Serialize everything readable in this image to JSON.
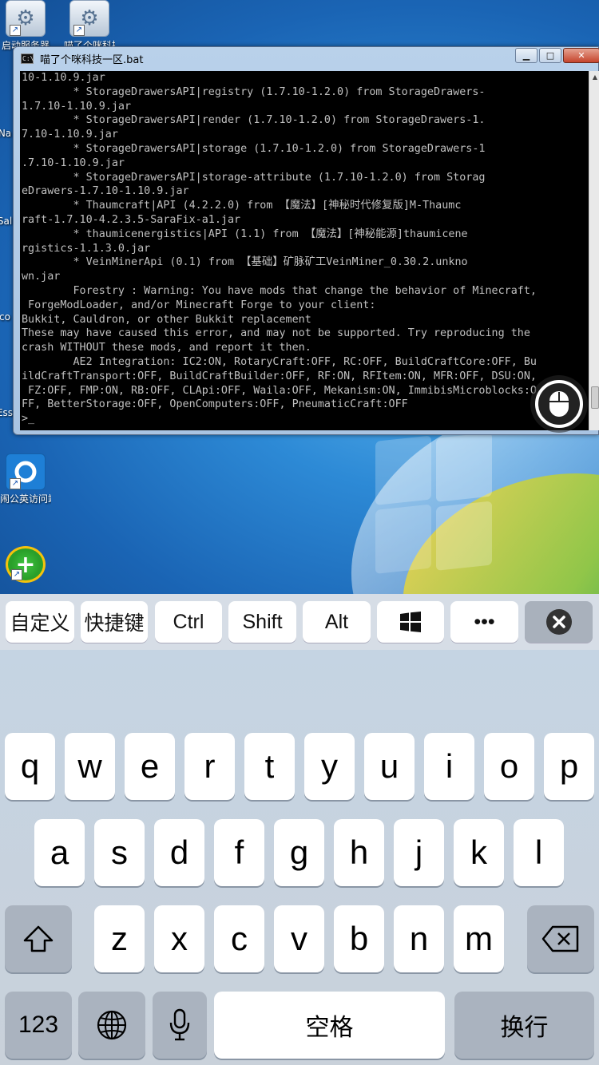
{
  "desktop": {
    "icons": [
      {
        "label": "启动服务器"
      },
      {
        "label": "喵了个咪科技"
      },
      {
        "label": "Na"
      },
      {
        "label": "Sal"
      },
      {
        "label": "co"
      },
      {
        "label": "Ess"
      },
      {
        "label": "闹公英访问端"
      },
      {
        "label": ""
      }
    ]
  },
  "console": {
    "title": "喵了个咪科技一区.bat",
    "window_buttons": {
      "minimize": "▁",
      "maximize": "□",
      "close": "✕"
    },
    "lines": [
      "10-1.10.9.jar",
      "        * StorageDrawersAPI|registry (1.7.10-1.2.0) from StorageDrawers-",
      "1.7.10-1.10.9.jar",
      "        * StorageDrawersAPI|render (1.7.10-1.2.0) from StorageDrawers-1.",
      "7.10-1.10.9.jar",
      "        * StorageDrawersAPI|storage (1.7.10-1.2.0) from StorageDrawers-1",
      ".7.10-1.10.9.jar",
      "        * StorageDrawersAPI|storage-attribute (1.7.10-1.2.0) from Storag",
      "eDrawers-1.7.10-1.10.9.jar",
      "        * Thaumcraft|API (4.2.2.0) from 【魔法】[神秘时代修复版]M-Thaumc",
      "raft-1.7.10-4.2.3.5-SaraFix-a1.jar",
      "        * thaumicenergistics|API (1.1) from 【魔法】[神秘能源]thaumicene",
      "rgistics-1.1.3.0.jar",
      "        * VeinMinerApi (0.1) from 【基础】矿脉矿工VeinMiner_0.30.2.unkno",
      "wn.jar",
      "        Forestry : Warning: You have mods that change the behavior of Minecraft,",
      " ForgeModLoader, and/or Minecraft Forge to your client:",
      "Bukkit, Cauldron, or other Bukkit replacement",
      "These may have caused this error, and may not be supported. Try reproducing the",
      "crash WITHOUT these mods, and report it then.",
      "        AE2 Integration: IC2:ON, RotaryCraft:OFF, RC:OFF, BuildCraftCore:OFF, Bu",
      "ildCraftTransport:OFF, BuildCraftBuilder:OFF, RF:ON, RFItem:ON, MFR:OFF, DSU:ON,",
      " FZ:OFF, FMP:ON, RB:OFF, CLApi:OFF, Waila:OFF, Mekanism:ON, ImmibisMicroblocks:O",
      "FF, BetterStorage:OFF, OpenComputers:OFF, PneumaticCraft:OFF",
      ">_"
    ]
  },
  "accessory_bar": {
    "custom": "自定义",
    "shortcut": "快捷键",
    "ctrl": "Ctrl",
    "shift": "Shift",
    "alt": "Alt",
    "windows_icon": "windows-logo",
    "more": "•••",
    "close_icon": "close-circle"
  },
  "keyboard": {
    "row1": [
      "q",
      "w",
      "e",
      "r",
      "t",
      "y",
      "u",
      "i",
      "o",
      "p"
    ],
    "row2": [
      "a",
      "s",
      "d",
      "f",
      "g",
      "h",
      "j",
      "k",
      "l"
    ],
    "row3": [
      "z",
      "x",
      "c",
      "v",
      "b",
      "n",
      "m"
    ],
    "numbers": "123",
    "space": "空格",
    "return": "换行"
  },
  "colors": {
    "console_bg": "#000000",
    "console_text": "#c0c0c0",
    "keyboard_bg": "#c9d1da",
    "key_bg": "#ffffff",
    "function_key_bg": "#aab3bf"
  }
}
